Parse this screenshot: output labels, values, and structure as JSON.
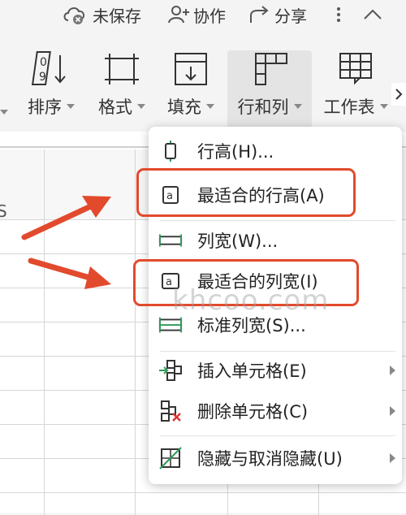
{
  "topbar": {
    "unsaved": "未保存",
    "collab": "协作",
    "share": "分享"
  },
  "ribbon": {
    "sort": "排序",
    "format": "格式",
    "fill": "填充",
    "rowcol": "行和列",
    "sheet": "工作表"
  },
  "sheet": {
    "partial_header": "S"
  },
  "menu": {
    "items": [
      {
        "label": "行高(H)...",
        "icon": "row-height-icon"
      },
      {
        "label": "最适合的行高(A)",
        "icon": "autofit-row-icon"
      },
      {
        "label": "列宽(W)...",
        "icon": "column-width-icon"
      },
      {
        "label": "最适合的列宽(I)",
        "icon": "autofit-column-icon"
      },
      {
        "label": "标准列宽(S)...",
        "icon": "standard-width-icon"
      },
      {
        "label": "插入单元格(E)",
        "icon": "insert-cells-icon",
        "submenu": true
      },
      {
        "label": "删除单元格(C)",
        "icon": "delete-cells-icon",
        "submenu": true
      },
      {
        "label": "隐藏与取消隐藏(U)",
        "icon": "hide-unhide-icon",
        "submenu": true
      }
    ]
  },
  "watermark": {
    "text": "khcoo.com"
  },
  "colors": {
    "highlight": "#e24a2d",
    "arrow": "#e24a2d",
    "delete_mark": "#e03030"
  }
}
